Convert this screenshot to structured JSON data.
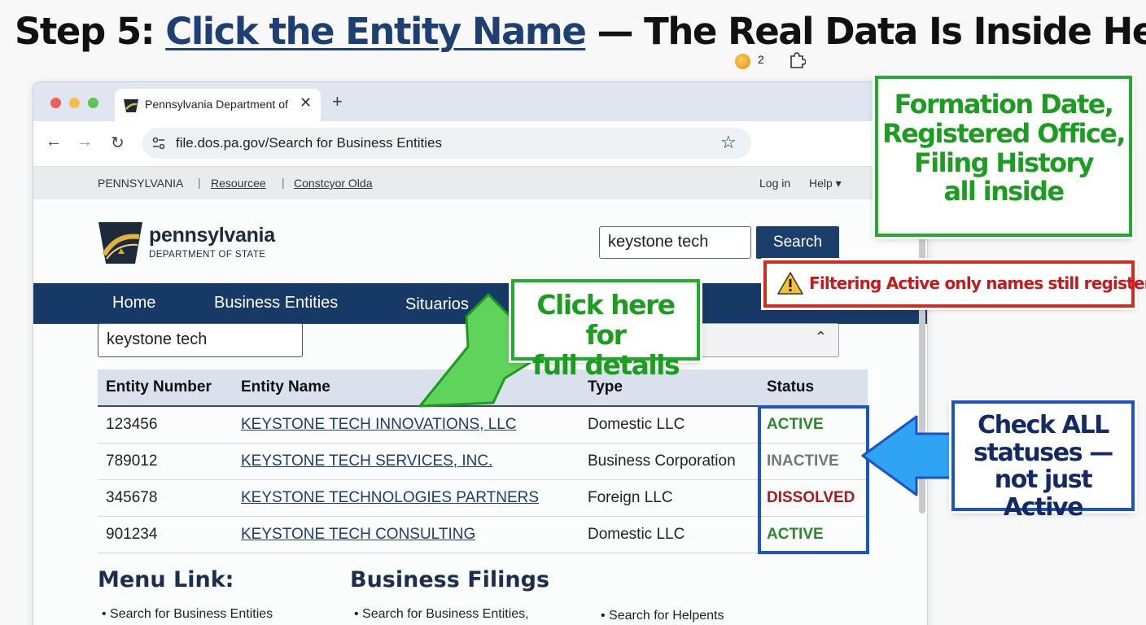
{
  "headline": {
    "prefix": "Step 5: ",
    "link": "Click the Entity Name",
    "suffix": " — The Real Data Is Inside Here"
  },
  "browser": {
    "tab_title": "Pennsylvania Department of State",
    "tab_close": "✕",
    "new_tab": "+",
    "back": "←",
    "forward": "→",
    "reload": "↻",
    "url": "file.dos.pa.gov/Search for Business Entities",
    "bookmark": "☆",
    "extension_count": "2"
  },
  "utility_bar": {
    "state": "PENNSYLVANIA",
    "sep": "|",
    "link1": "Resourcee",
    "link2": "Constcyor Olda",
    "login": "Log in",
    "help": "Help ▾"
  },
  "site": {
    "logo_name": "pennsylvania",
    "logo_sub": "DEPARTMENT OF STATE",
    "search_value": "keystone tech",
    "search_button": "Search"
  },
  "main_nav": [
    {
      "label": "Home"
    },
    {
      "label": "Business Entities"
    },
    {
      "label": "Situarios ⌄"
    }
  ],
  "filter": {
    "query": "keystone tech",
    "select_chevron": "⌃"
  },
  "results": {
    "headers": [
      "Entity Number",
      "Entity Name",
      "Type",
      "Status"
    ],
    "rows": [
      {
        "number": "123456",
        "name": "KEYSTONE TECH INNOVATIONS, LLC",
        "type": "Domestic LLC",
        "status": "ACTIVE",
        "status_color": "#2a8a2a"
      },
      {
        "number": "789012",
        "name": "KEYSTONE TECH SERVICES, INC.",
        "type": "Business Corporation",
        "status": "INACTIVE",
        "status_color": "#777777"
      },
      {
        "number": "345678",
        "name": "KEYSTONE TECHNOLOGIES PARTNERS",
        "type": "Foreign LLC",
        "status": "DISSOLVED",
        "status_color": "#b3161b"
      },
      {
        "number": "901234",
        "name": "KEYSTONE TECH CONSULTING",
        "type": "Domestic LLC",
        "status": "ACTIVE",
        "status_color": "#2a8a2a"
      }
    ]
  },
  "footer": {
    "menu_title": "Menu Link:",
    "menu_item": "• Search for Business Entities",
    "filings_title": "Business Filings",
    "filings_item": "• Search for Business Entities,",
    "helpents_item": "• Search for Helpents"
  },
  "callouts": {
    "top_lines": [
      "Formation Date,",
      "Registered Office,",
      "Filing History",
      "all inside"
    ],
    "warning": "Filtering Active only  names still registered",
    "click_lines": [
      "Click here for",
      "full details"
    ],
    "check_lines": [
      "Check ALL",
      "statuses —",
      "not just Active"
    ]
  },
  "colors": {
    "navy": "#173966",
    "callout_green": "#1fad2c",
    "callout_red": "#d42a22",
    "callout_blue": "#1b54c8",
    "arrow_green": "#5fd35a",
    "arrow_blue": "#2fa4f2"
  }
}
